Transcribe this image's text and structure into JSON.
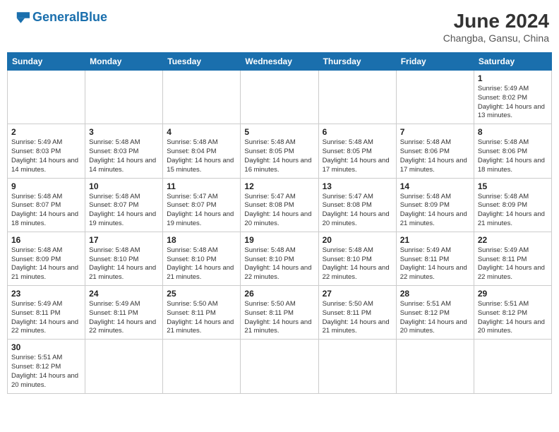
{
  "header": {
    "logo_general": "General",
    "logo_blue": "Blue",
    "month_title": "June 2024",
    "location": "Changba, Gansu, China"
  },
  "weekdays": [
    "Sunday",
    "Monday",
    "Tuesday",
    "Wednesday",
    "Thursday",
    "Friday",
    "Saturday"
  ],
  "weeks": [
    [
      {
        "day": "",
        "info": ""
      },
      {
        "day": "",
        "info": ""
      },
      {
        "day": "",
        "info": ""
      },
      {
        "day": "",
        "info": ""
      },
      {
        "day": "",
        "info": ""
      },
      {
        "day": "",
        "info": ""
      },
      {
        "day": "1",
        "info": "Sunrise: 5:49 AM\nSunset: 8:02 PM\nDaylight: 14 hours and 13 minutes."
      }
    ],
    [
      {
        "day": "2",
        "info": "Sunrise: 5:49 AM\nSunset: 8:03 PM\nDaylight: 14 hours and 14 minutes."
      },
      {
        "day": "3",
        "info": "Sunrise: 5:48 AM\nSunset: 8:03 PM\nDaylight: 14 hours and 14 minutes."
      },
      {
        "day": "4",
        "info": "Sunrise: 5:48 AM\nSunset: 8:04 PM\nDaylight: 14 hours and 15 minutes."
      },
      {
        "day": "5",
        "info": "Sunrise: 5:48 AM\nSunset: 8:05 PM\nDaylight: 14 hours and 16 minutes."
      },
      {
        "day": "6",
        "info": "Sunrise: 5:48 AM\nSunset: 8:05 PM\nDaylight: 14 hours and 17 minutes."
      },
      {
        "day": "7",
        "info": "Sunrise: 5:48 AM\nSunset: 8:06 PM\nDaylight: 14 hours and 17 minutes."
      },
      {
        "day": "8",
        "info": "Sunrise: 5:48 AM\nSunset: 8:06 PM\nDaylight: 14 hours and 18 minutes."
      }
    ],
    [
      {
        "day": "9",
        "info": "Sunrise: 5:48 AM\nSunset: 8:07 PM\nDaylight: 14 hours and 18 minutes."
      },
      {
        "day": "10",
        "info": "Sunrise: 5:48 AM\nSunset: 8:07 PM\nDaylight: 14 hours and 19 minutes."
      },
      {
        "day": "11",
        "info": "Sunrise: 5:47 AM\nSunset: 8:07 PM\nDaylight: 14 hours and 19 minutes."
      },
      {
        "day": "12",
        "info": "Sunrise: 5:47 AM\nSunset: 8:08 PM\nDaylight: 14 hours and 20 minutes."
      },
      {
        "day": "13",
        "info": "Sunrise: 5:47 AM\nSunset: 8:08 PM\nDaylight: 14 hours and 20 minutes."
      },
      {
        "day": "14",
        "info": "Sunrise: 5:48 AM\nSunset: 8:09 PM\nDaylight: 14 hours and 21 minutes."
      },
      {
        "day": "15",
        "info": "Sunrise: 5:48 AM\nSunset: 8:09 PM\nDaylight: 14 hours and 21 minutes."
      }
    ],
    [
      {
        "day": "16",
        "info": "Sunrise: 5:48 AM\nSunset: 8:09 PM\nDaylight: 14 hours and 21 minutes."
      },
      {
        "day": "17",
        "info": "Sunrise: 5:48 AM\nSunset: 8:10 PM\nDaylight: 14 hours and 21 minutes."
      },
      {
        "day": "18",
        "info": "Sunrise: 5:48 AM\nSunset: 8:10 PM\nDaylight: 14 hours and 21 minutes."
      },
      {
        "day": "19",
        "info": "Sunrise: 5:48 AM\nSunset: 8:10 PM\nDaylight: 14 hours and 22 minutes."
      },
      {
        "day": "20",
        "info": "Sunrise: 5:48 AM\nSunset: 8:10 PM\nDaylight: 14 hours and 22 minutes."
      },
      {
        "day": "21",
        "info": "Sunrise: 5:49 AM\nSunset: 8:11 PM\nDaylight: 14 hours and 22 minutes."
      },
      {
        "day": "22",
        "info": "Sunrise: 5:49 AM\nSunset: 8:11 PM\nDaylight: 14 hours and 22 minutes."
      }
    ],
    [
      {
        "day": "23",
        "info": "Sunrise: 5:49 AM\nSunset: 8:11 PM\nDaylight: 14 hours and 22 minutes."
      },
      {
        "day": "24",
        "info": "Sunrise: 5:49 AM\nSunset: 8:11 PM\nDaylight: 14 hours and 22 minutes."
      },
      {
        "day": "25",
        "info": "Sunrise: 5:50 AM\nSunset: 8:11 PM\nDaylight: 14 hours and 21 minutes."
      },
      {
        "day": "26",
        "info": "Sunrise: 5:50 AM\nSunset: 8:11 PM\nDaylight: 14 hours and 21 minutes."
      },
      {
        "day": "27",
        "info": "Sunrise: 5:50 AM\nSunset: 8:11 PM\nDaylight: 14 hours and 21 minutes."
      },
      {
        "day": "28",
        "info": "Sunrise: 5:51 AM\nSunset: 8:12 PM\nDaylight: 14 hours and 20 minutes."
      },
      {
        "day": "29",
        "info": "Sunrise: 5:51 AM\nSunset: 8:12 PM\nDaylight: 14 hours and 20 minutes."
      }
    ],
    [
      {
        "day": "30",
        "info": "Sunrise: 5:51 AM\nSunset: 8:12 PM\nDaylight: 14 hours and 20 minutes."
      },
      {
        "day": "",
        "info": ""
      },
      {
        "day": "",
        "info": ""
      },
      {
        "day": "",
        "info": ""
      },
      {
        "day": "",
        "info": ""
      },
      {
        "day": "",
        "info": ""
      },
      {
        "day": "",
        "info": ""
      }
    ]
  ]
}
